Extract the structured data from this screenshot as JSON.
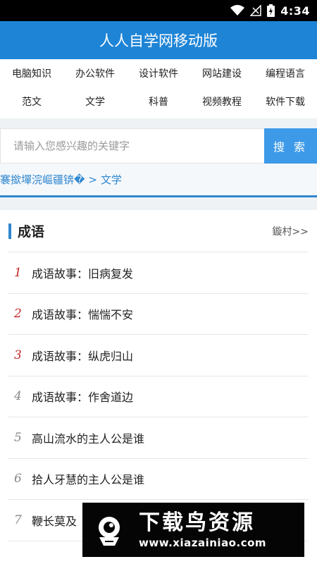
{
  "status_bar": {
    "time": "4:34"
  },
  "header": {
    "title": "人人自学网移动版"
  },
  "nav": {
    "items": [
      "电脑知识",
      "办公软件",
      "设计软件",
      "网站建设",
      "编程语言",
      "范文",
      "文学",
      "科普",
      "视频教程",
      "软件下载"
    ]
  },
  "search": {
    "placeholder": "请输入您感兴趣的关键字",
    "button": "搜 索"
  },
  "breadcrumb": {
    "home": "褰撳墠浣嶇疆锛�",
    "separator": ">",
    "current": "文学"
  },
  "section": {
    "title": "成语",
    "more": "鏇村>>"
  },
  "articles": [
    {
      "rank": "1",
      "title": "成语故事：旧病复发"
    },
    {
      "rank": "2",
      "title": "成语故事：惴惴不安"
    },
    {
      "rank": "3",
      "title": "成语故事：纵虎归山"
    },
    {
      "rank": "4",
      "title": "成语故事：作舍道边"
    },
    {
      "rank": "5",
      "title": "高山流水的主人公是谁"
    },
    {
      "rank": "6",
      "title": "拾人牙慧的主人公是谁"
    },
    {
      "rank": "7",
      "title": "鞭长莫及"
    }
  ],
  "watermark": {
    "name": "下载鸟资源",
    "url": "www.xiazainiao.com"
  }
}
